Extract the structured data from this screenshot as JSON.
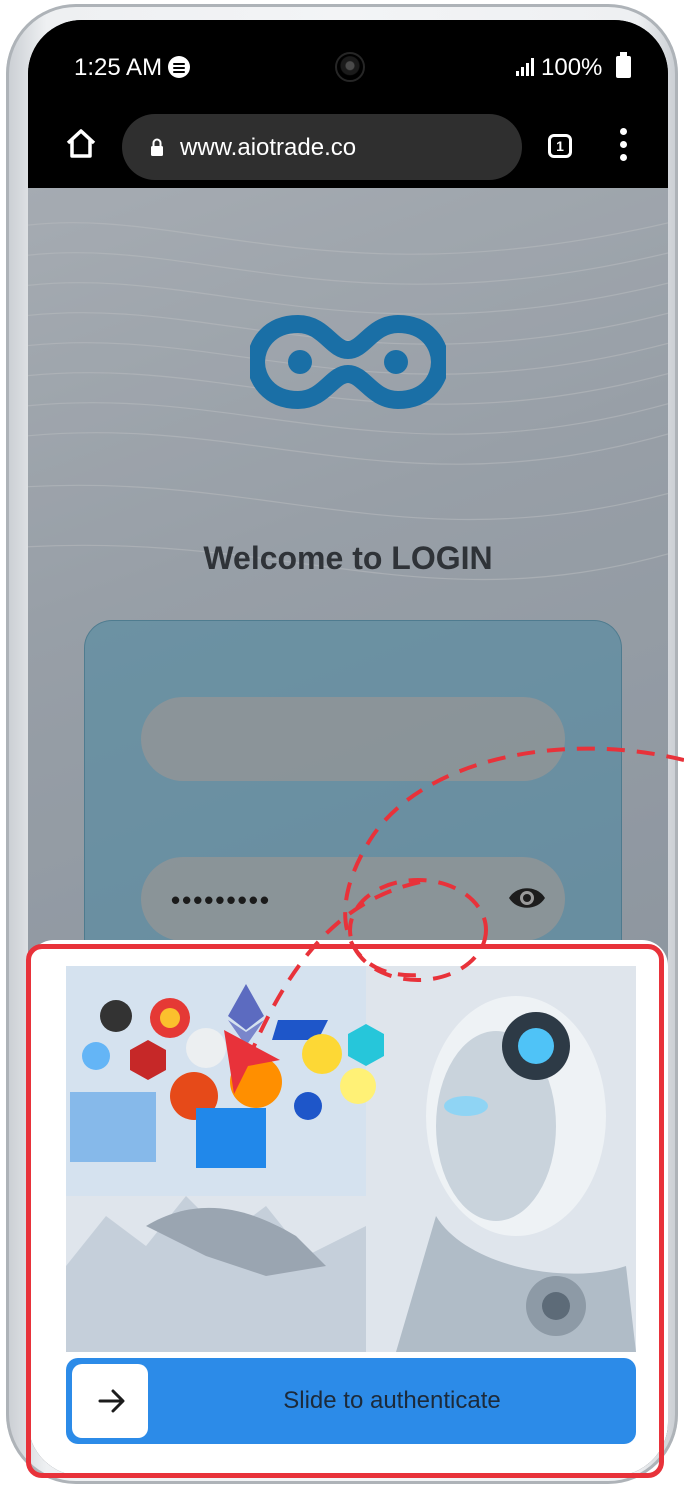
{
  "status_bar": {
    "time": "1:25 AM",
    "battery": "100%"
  },
  "browser": {
    "url": "www.aiotrade.co",
    "tab_count": "1"
  },
  "page": {
    "welcome_heading": "Welcome to LOGIN",
    "password_masked": "•••••••••"
  },
  "captcha": {
    "slider_label": "Slide to authenticate"
  },
  "icons": {
    "home": "home-icon",
    "lock": "lock-icon",
    "tabs": "tabs-icon",
    "menu": "more-vert-icon",
    "eye": "eye-icon",
    "arrow": "arrow-right-icon"
  },
  "colors": {
    "slider": "#2c8be8",
    "highlight": "#e8323a",
    "logo": "#1a6fa6"
  }
}
